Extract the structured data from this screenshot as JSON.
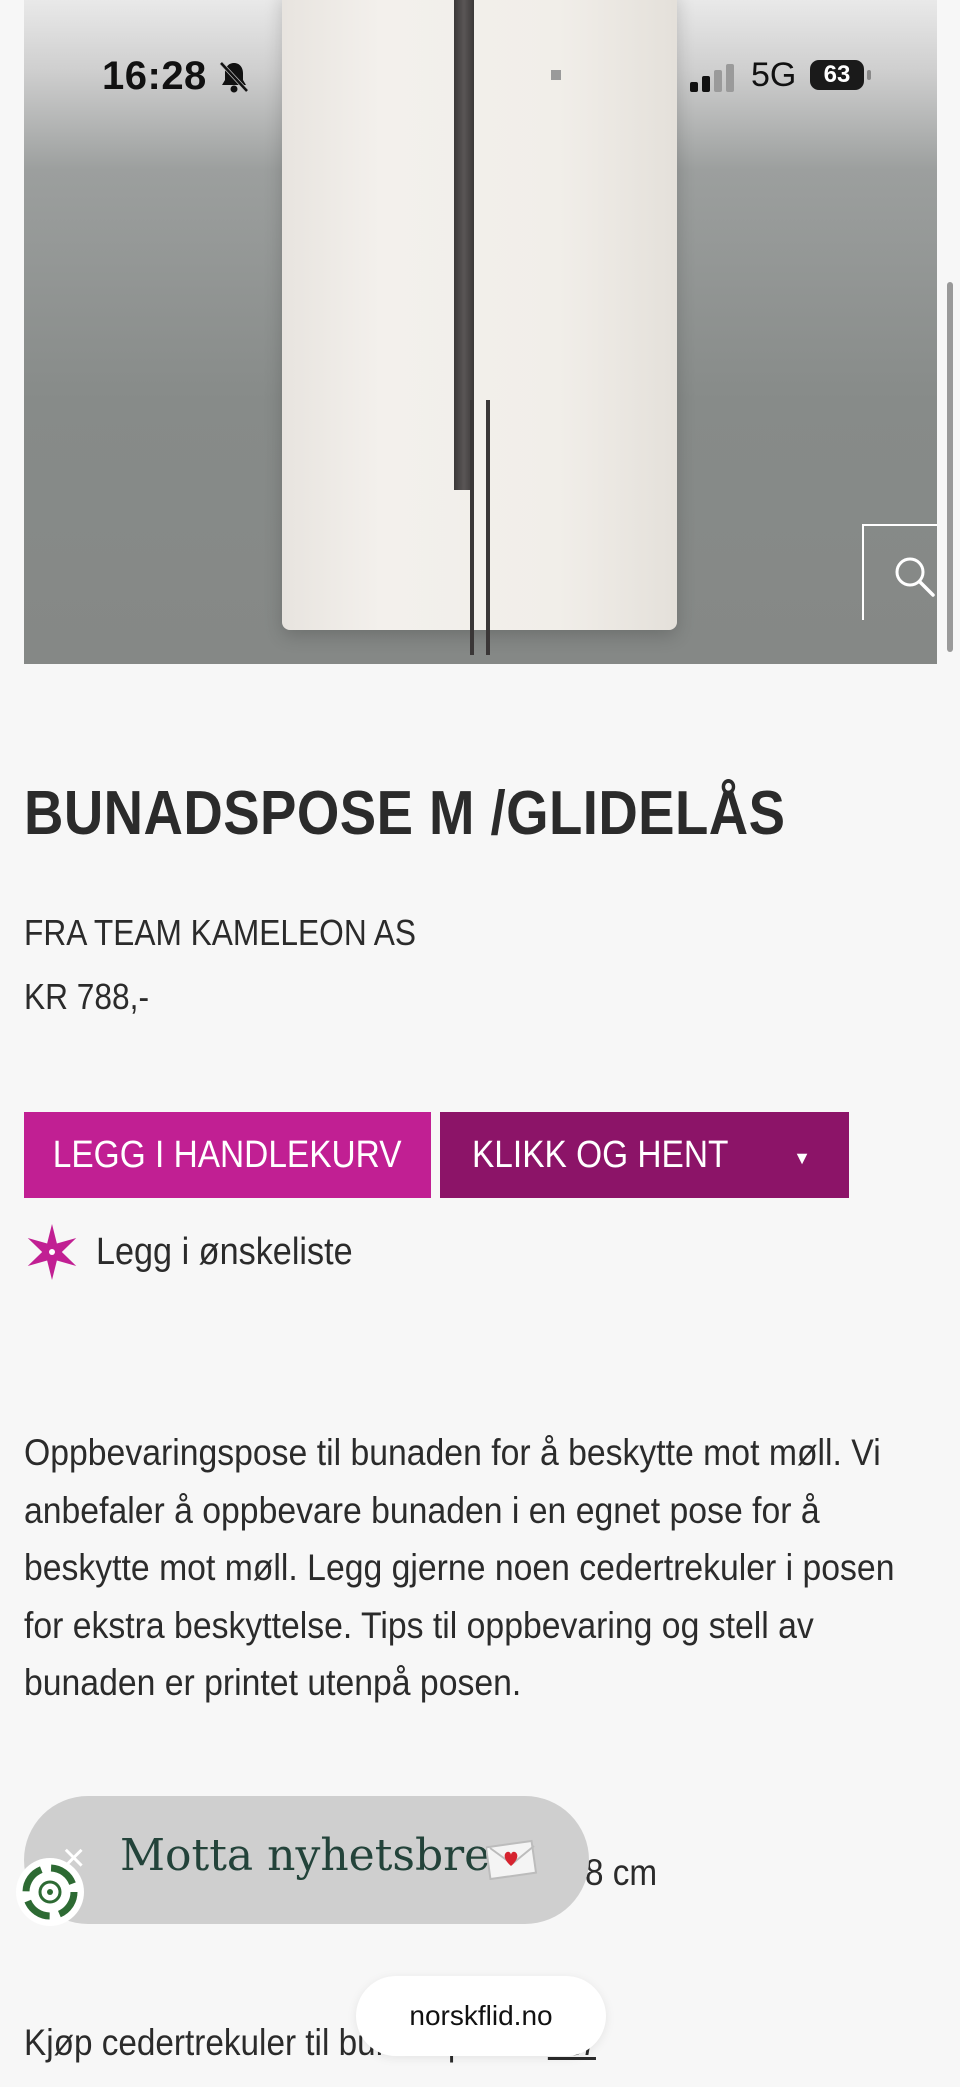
{
  "status_bar": {
    "time": "16:28",
    "network": "5G",
    "battery": "63"
  },
  "product": {
    "title": "BUNADSPOSE M /GLIDELÅS",
    "brand": "FRA TEAM KAMELEON AS",
    "price": "KR 788,-",
    "image_icon": "zoom-icon"
  },
  "actions": {
    "add_to_cart": "LEGG I HANDLEKURV",
    "click_collect": "KLIKK OG HENT",
    "wishlist": "Legg i ønskeliste"
  },
  "description": "Oppbevaringspose til bunaden for å beskytte mot møll. Vi anbefaler å oppbevare bunaden i en egnet pose for å beskytte mot møll. Legg gjerne noen cedertrekuler i posen for ekstra beskyttelse. Tips til oppbevaring og stell av bunaden er printet utenpå posen.",
  "size_text": "8 cm",
  "newsletter": {
    "close": "×",
    "label": "Motta nyhetsbrev"
  },
  "bottom": {
    "text": "Kjøp cedertrekuler til bunadsposen",
    "link": "her"
  },
  "browser": {
    "url": "norskflid.no"
  },
  "colors": {
    "primary_button": "#c11f93",
    "secondary_button": "#8c1468",
    "newsletter_text": "#23433a"
  }
}
